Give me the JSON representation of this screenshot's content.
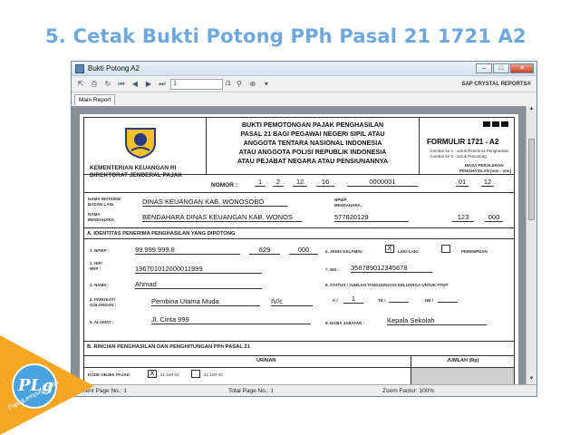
{
  "slide": {
    "title": "5. Cetak Bukti Potong PPh Pasal 21 1721 A2"
  },
  "window": {
    "title": "Bukti Potong A2"
  },
  "toolbar": {
    "page_input": "1",
    "page_total": "/1",
    "brand": "SAP CRYSTAL REPORTS®"
  },
  "tabs": [
    {
      "label": "Main Report"
    }
  ],
  "form": {
    "ministry": "KEMENTERIAN KEUANGAN RI",
    "directorate": "DIREKTORAT JENDERAL PAJAK",
    "header_lines": [
      "BUKTI PEMOTONGAN PAJAK PENGHASILAN",
      "PASAL 21 BAGI PEGAWAI NEGERI SIPIL ATAU",
      "ANGGOTA TENTARA NASIONAL INDONESIA",
      "ATAU ANGGOTA POLISI REPUBLIK INDONESIA",
      "ATAU  PEJABAT NEGARA ATAU PENSIUNANNYA"
    ],
    "form_code": "FORMULIR 1721 - A2",
    "lembar1": "Lembar ke-1 : untuk Penerima Penghasilan",
    "lembar2": "Lembar ke-2 : untuk Pemotong",
    "masa_label": "MASA PEROLEHAN",
    "masa_label2": "PENGHASILAN [mm - mm]",
    "masa_from": "01",
    "masa_to": "12",
    "nomor_label": "NOMOR :",
    "nomor": [
      "1",
      "2",
      "12",
      "16",
      "0000001"
    ],
    "instansi_label": "NAMA INSTANSI/",
    "instansi_label2": "BADAN LAIN",
    "instansi_value": "DINAS KEUANGAN KAB. WONOSOBO",
    "bendahara_label": "NAMA",
    "bendahara_label2": "BENDAHARA",
    "bendahara_value": "BENDAHARA DINAS KEUANGAN KAB. WONOS",
    "npwp_bend_label": "NPWP",
    "npwp_bend_label2": "BENDAHARA :",
    "npwp_bend_value": "577820129",
    "npwp_bend_p2": "123",
    "npwp_bend_p3": "000",
    "section_a": "A. IDENTITAS PENERIMA PENGHASILAN YANG DIPOTONG",
    "npwp_label": "1. NPWP :",
    "npwp_value": "99.999.999.8",
    "npwp_p2": "629",
    "npwp_p3": "000",
    "nip_label": "2. NIP/",
    "nip_label2": "NRP :",
    "nip_value": "196701012000011999",
    "nama_label": "3. NAMA :",
    "nama_value": "Ahmad",
    "pangkat_label": "4. PANGKAT/",
    "pangkat_label2": "GOLONGAN :",
    "pangkat_value": "Pembina Utama Muda",
    "golongan_value": "IV/c",
    "alamat_label": "5. ALAMAT :",
    "alamat_value": "Jl. Cinta 999",
    "jk_label": "6. JENIS KELAMIN :",
    "jk_check": "X",
    "laki": "LAKI-LAKI",
    "perempuan": "PEREMPUAN",
    "nik_label": "7. NIK :",
    "nik_value": "356789012345678",
    "status_label": "8. STATUS / JUMLAH TANGGUNGAN KELUARGA UNTUK PTKP",
    "k_label": "K /",
    "k_value": "1",
    "tk_label": "TK /",
    "hb_label": "HB /",
    "jabatan_label": "9. NAMA JABATAN :",
    "jabatan_value": "Kepala Sekolah",
    "section_b": "B. RINCIAN PENGHASILAN DAN PENGHITUNGAN PPh PASAL 21",
    "uraian": "URAIAN",
    "jumlah": "JUMLAH (Rp)",
    "kode_label": "KODE OBJEK PAJAK:",
    "kode_check": "X",
    "kode1": "21-100-01",
    "kode2": "21-100-02"
  },
  "status": {
    "current": "Current Page No.: 1",
    "total": "Total Page No.: 1",
    "zoom": "Zoom Factor: 100%"
  },
  "watermark": {
    "text": "PLg",
    "site": "PajegLempung.com"
  },
  "colors": {
    "title": "#6fa8dc",
    "viewer_bg": "#8a8f95",
    "plg_orange": "#f5a623"
  }
}
